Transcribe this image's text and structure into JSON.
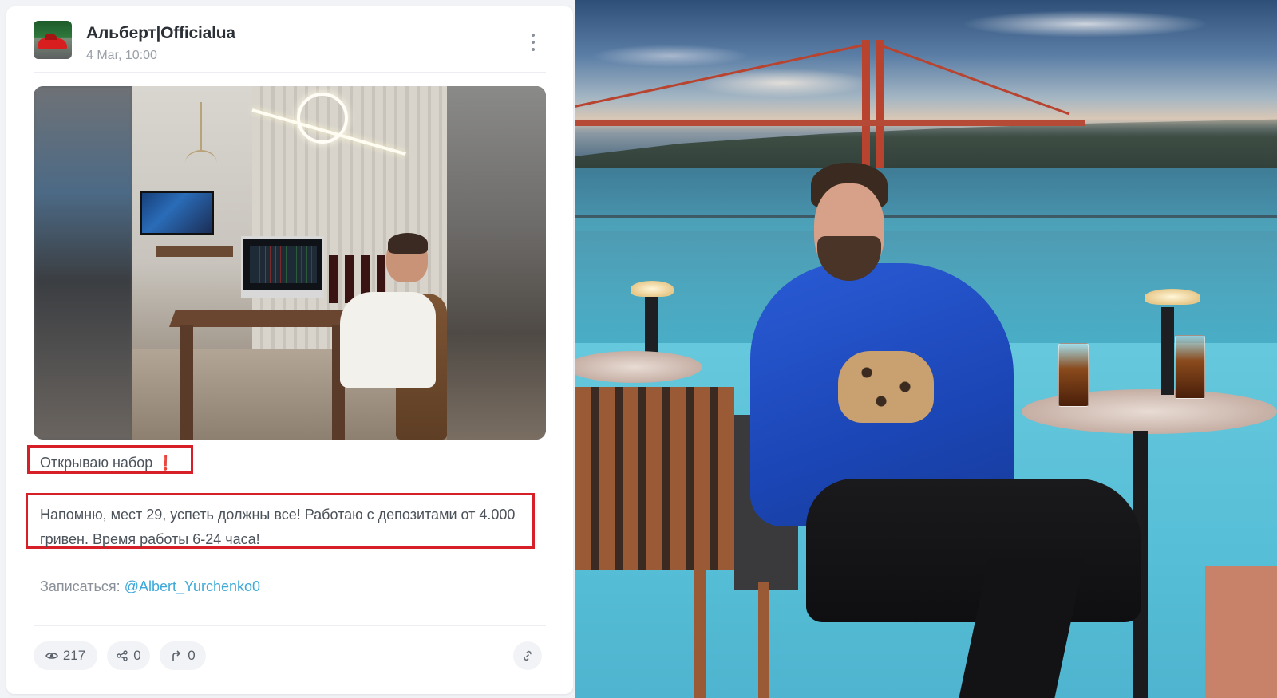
{
  "post": {
    "channel_name": "Альберт|Officialua",
    "date": "4 Mar, 10:00",
    "heading": "Открываю набор",
    "heading_emoji": "❗",
    "body": "Напомню, мест 29, успеть должны все! Работаю с депозитами от 4.000 гривен. Время работы 6-24 часа!",
    "signup_label": "Записаться:",
    "signup_handle": "@Albert_Yurchenko0",
    "stats": {
      "views": "217",
      "reactions": "0",
      "shares": "0"
    },
    "icons": {
      "more": "more-vertical-icon",
      "views": "eye-icon",
      "reactions": "share-nodes-icon",
      "shares": "forward-arrow-icon",
      "link": "link-icon"
    },
    "colors": {
      "highlight": "#d61f26",
      "link": "#3ea9d8",
      "text": "#4c525a",
      "muted": "#9aa0a8"
    }
  }
}
